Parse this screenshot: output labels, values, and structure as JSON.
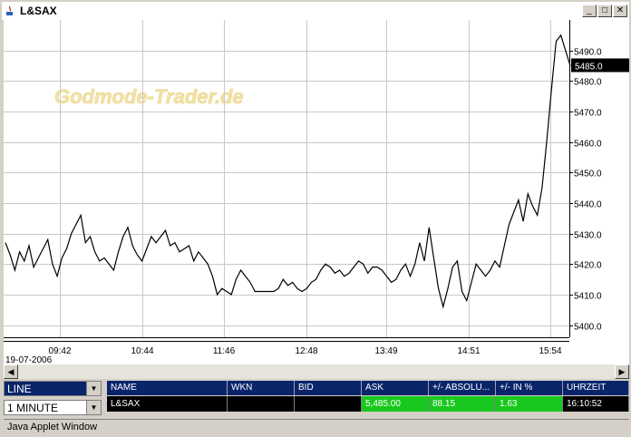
{
  "window": {
    "title": "L&SAX",
    "minimize": "_",
    "maximize": "□",
    "close": "✕"
  },
  "watermark": "Godmode-Trader.de",
  "chart_data": {
    "type": "line",
    "title": "",
    "date_label": "19-07-2006",
    "x_ticks": [
      "09:42",
      "10:44",
      "11:46",
      "12:48",
      "13:49",
      "14:51",
      "15:54"
    ],
    "y_ticks": [
      "5490.0",
      "5480.0",
      "5470.0",
      "5460.0",
      "5450.0",
      "5440.0",
      "5430.0",
      "5420.0",
      "5410.0",
      "5400.0"
    ],
    "ylim": [
      5396,
      5500
    ],
    "last_value_label": "5485.0",
    "grid": true,
    "series": [
      {
        "values": [
          5427,
          5423,
          5418,
          5424,
          5421,
          5426,
          5419,
          5422,
          5425,
          5428,
          5420,
          5416,
          5422,
          5425,
          5430,
          5433,
          5436,
          5427,
          5429,
          5424,
          5421,
          5422,
          5420,
          5418,
          5424,
          5429,
          5432,
          5426,
          5423,
          5421,
          5425,
          5429,
          5427,
          5429,
          5431,
          5426,
          5427,
          5424,
          5425,
          5426,
          5421,
          5424,
          5422,
          5420,
          5416,
          5410,
          5412,
          5411,
          5410,
          5415,
          5418,
          5416,
          5414,
          5411,
          5411,
          5411,
          5411,
          5411,
          5412,
          5415,
          5413,
          5414,
          5412,
          5411,
          5412,
          5414,
          5415,
          5418,
          5420,
          5419,
          5417,
          5418,
          5416,
          5417,
          5419,
          5421,
          5420,
          5417,
          5419,
          5419,
          5418,
          5416,
          5414,
          5415,
          5418,
          5420,
          5416,
          5420,
          5427,
          5421,
          5432,
          5422,
          5412,
          5406,
          5412,
          5419,
          5421,
          5411,
          5408,
          5414,
          5420,
          5418,
          5416,
          5418,
          5421,
          5419,
          5426,
          5433,
          5437,
          5441,
          5434,
          5443,
          5439,
          5436,
          5445,
          5460,
          5477,
          5493,
          5495,
          5490,
          5485
        ]
      }
    ]
  },
  "scrollbar": {
    "left_arrow": "◀",
    "right_arrow": "▶"
  },
  "controls": {
    "chart_type": "LINE",
    "interval": "1 MINUTE"
  },
  "quote_table": {
    "columns": [
      "NAME",
      "WKN",
      "BID",
      "ASK",
      "+/- ABSOLU...",
      "+/- IN %",
      "UHRZEIT"
    ],
    "row": [
      "L&SAX",
      "",
      "",
      "5,485.00",
      "88.15",
      "1.63",
      "16:10:52"
    ]
  },
  "status_bar": "Java Applet Window",
  "colors": {
    "header": "#0a246a",
    "positive": "#19c81e",
    "line": "#000000"
  }
}
